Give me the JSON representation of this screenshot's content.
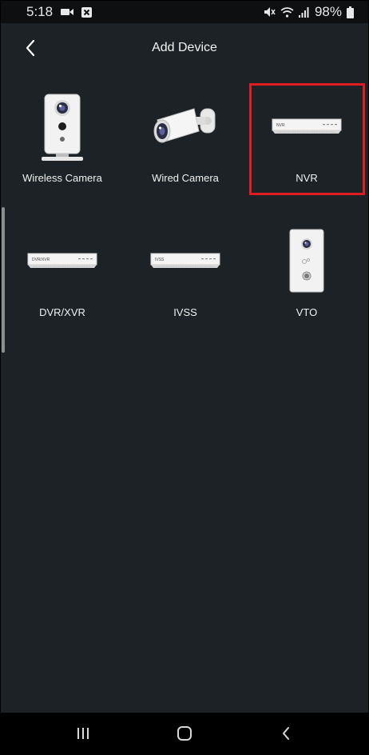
{
  "status_bar": {
    "time": "5:18",
    "battery_percent": "98%",
    "icons": [
      "video-icon",
      "notification-x-icon",
      "mute-icon",
      "wifi-icon",
      "signal-icon",
      "battery-icon"
    ]
  },
  "header": {
    "title": "Add Device",
    "back_icon": "chevron-left-icon"
  },
  "devices": [
    {
      "label": "Wireless Camera",
      "icon": "wireless-camera-icon"
    },
    {
      "label": "Wired Camera",
      "icon": "wired-camera-icon"
    },
    {
      "label": "NVR",
      "icon": "nvr-icon",
      "highlighted": true
    },
    {
      "label": "DVR/XVR",
      "icon": "dvr-xvr-icon",
      "device_text": "DVR/XVR"
    },
    {
      "label": "IVSS",
      "icon": "ivss-icon",
      "device_text": "IVSS"
    },
    {
      "label": "VTO",
      "icon": "vto-icon"
    }
  ],
  "nvr_device_text": "NVR",
  "nav_bar": {
    "buttons": [
      "recents-icon",
      "home-icon",
      "back-icon"
    ]
  },
  "colors": {
    "background": "#1c2225",
    "highlight": "#e01b22",
    "text": "#ffffff"
  }
}
